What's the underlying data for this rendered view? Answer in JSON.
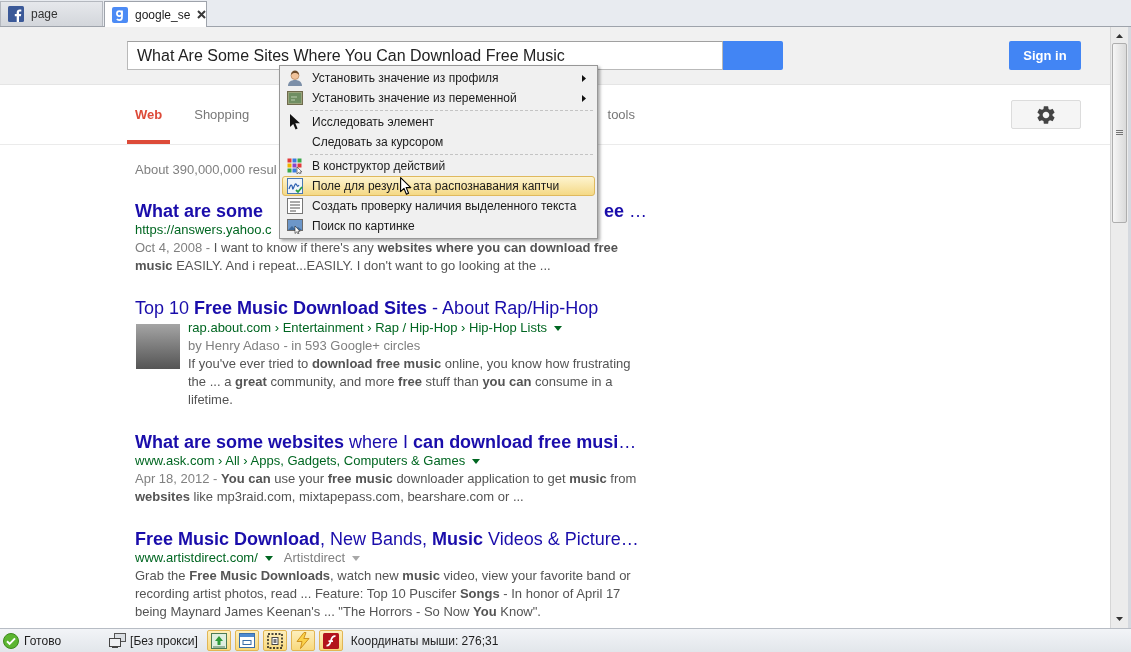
{
  "browser_tabs": [
    {
      "title": "page",
      "selected": false
    },
    {
      "title": "google_se",
      "selected": true
    }
  ],
  "header": {
    "search": {
      "value": "What Are Some Sites Where You Can Download Free Music"
    },
    "sign_in": "Sign in"
  },
  "nav": [
    {
      "label": "Web",
      "selected": true
    },
    {
      "label": "Shopping",
      "selected": false
    },
    {
      "label": "tools",
      "selected": false
    }
  ],
  "result_stats": "About 390,000,000 resul",
  "results": [
    {
      "title": "**What are some**",
      "title_end": "**ee** …",
      "url": "https://answers.yahoo.c",
      "date": "Oct 4, 2008 -",
      "snippet": "I want to know if there's any **websites where you can download free music** EASILY. And i repeat...EASILY. I don't want to go looking at the ..."
    },
    {
      "title": "Top 10 **Free Music Download Sites** - About Rap/Hip-Hop",
      "thumbnail": true,
      "url": "rap.about.com › Entertainment › Rap / Hip-Hop › Hip-Hop Lists",
      "url_menu": true,
      "author": "by Henry Adaso - in 593 Google+ circles",
      "snippet": "If you've ever tried to **download free music** online, you know how frustrating the ... a **great** community, and more **free** stuff than **you can** consume in a lifetime."
    },
    {
      "title": "**What are some websites** where I **can download free musi**…",
      "url": "www.ask.com › All › Apps, Gadgets, Computers & Games",
      "url_menu": true,
      "date": "Apr 18, 2012 -",
      "snippet": "**You can** use your **free music** downloader application to get **music** from **websites** like mp3raid.com, mixtapepass.com, bearshare.com or ..."
    },
    {
      "title": "**Free Music Download**, New Bands, **Music** Videos & Picture…",
      "url": "www.artistdirect.com/",
      "url_menu": true,
      "site_name": "Artistdirect",
      "snippet": "Grab the **Free Music Downloads**, watch new **music** video, view your favorite band or recording artist photos, read ... Feature: Top 10 Puscifer **Songs** - In honor of April 17 being Maynard James Keenan's ... \"The Horrors - So Now **You** Know\"."
    }
  ],
  "context_menu": {
    "groups": [
      [
        {
          "label": "Установить значение из профиля",
          "submenu": true,
          "highlighted": false
        },
        {
          "label": "Установить значение из переменной",
          "submenu": true,
          "highlighted": false
        }
      ],
      [
        {
          "label": "Исследовать элемент",
          "submenu": false,
          "highlighted": false
        },
        {
          "label": "Следовать за курсором",
          "submenu": false,
          "highlighted": false
        }
      ],
      [
        {
          "label": "В конструктор действий",
          "submenu": false,
          "highlighted": false
        },
        {
          "label": "Поле для резул",
          "label_end": "ата распознавания каптчи",
          "submenu": false,
          "highlighted": true
        },
        {
          "label": "Создать проверку наличия выделенного текста",
          "submenu": false,
          "highlighted": false
        },
        {
          "label": "Поиск по картинке",
          "submenu": false,
          "highlighted": false
        }
      ]
    ]
  },
  "status_bar": {
    "status": "Готово",
    "proxy": "[Без прокси]",
    "tools": [
      {
        "on": true
      },
      {
        "on": true
      },
      {
        "on": true
      },
      {
        "on": true
      },
      {
        "on": true
      }
    ],
    "mouse_coords": "Координаты мыши: 276;31"
  }
}
